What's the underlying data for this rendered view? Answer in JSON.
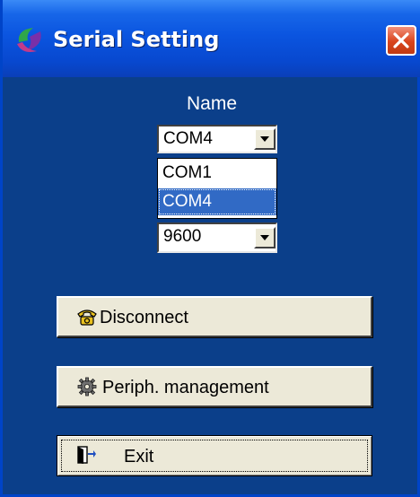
{
  "window": {
    "title": "Serial Setting"
  },
  "serial": {
    "name_label": "Name",
    "port_selected": "COM4",
    "port_options": [
      "COM1",
      "COM4"
    ],
    "baud_selected": "9600"
  },
  "buttons": {
    "disconnect": "Disconnect",
    "periph": "Periph. management",
    "exit": "Exit"
  },
  "icons": {
    "app": "app-logo-icon",
    "close": "close-icon",
    "disconnect": "telephone-icon",
    "periph": "gear-icon",
    "exit": "exit-door-icon"
  },
  "colors": {
    "titlebar": "#0B55E0",
    "background": "#0B3F8A",
    "selection": "#316AC5",
    "button_face": "#ECE9D8",
    "close_red": "#D9441C"
  }
}
